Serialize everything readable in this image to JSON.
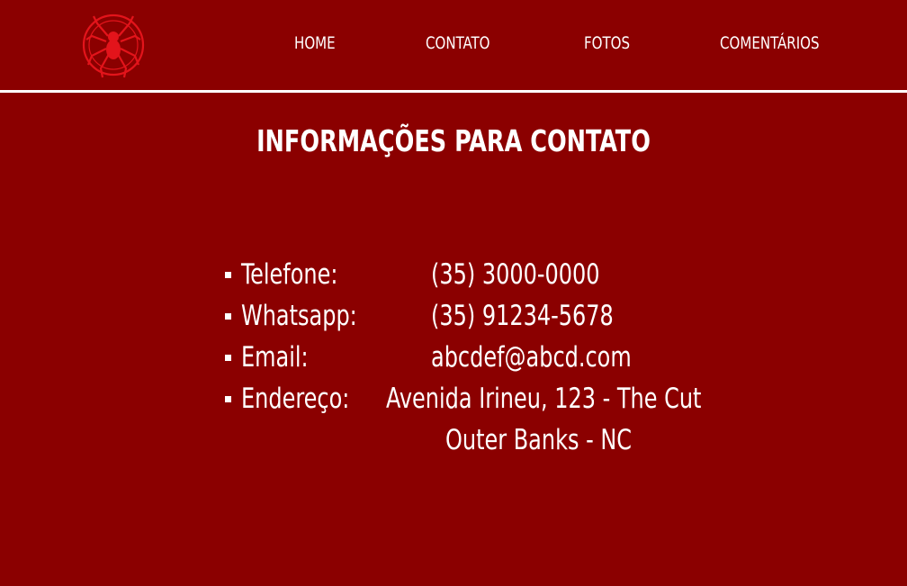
{
  "colors": {
    "background": "#8b0000",
    "text": "#ffffff",
    "logo": "#e3141b"
  },
  "header": {
    "logo_icon": "spider-emblem-icon",
    "nav": [
      {
        "label": "HOME"
      },
      {
        "label": "CONTATO"
      },
      {
        "label": "FOTOS"
      },
      {
        "label": "COMENTÁRIOS"
      }
    ]
  },
  "main": {
    "title": "INFORMAÇÕES PARA CONTATO",
    "contacts": [
      {
        "label": "Telefone:",
        "value": "(35) 3000-0000"
      },
      {
        "label": "Whatsapp:",
        "value": "(35) 91234-5678"
      },
      {
        "label": "Email:",
        "value": "abcdef@abcd.com"
      },
      {
        "label": "Endereço:",
        "value": "Avenida Irineu, 123 - The Cut",
        "value_line2": "Outer Banks - NC"
      }
    ]
  }
}
